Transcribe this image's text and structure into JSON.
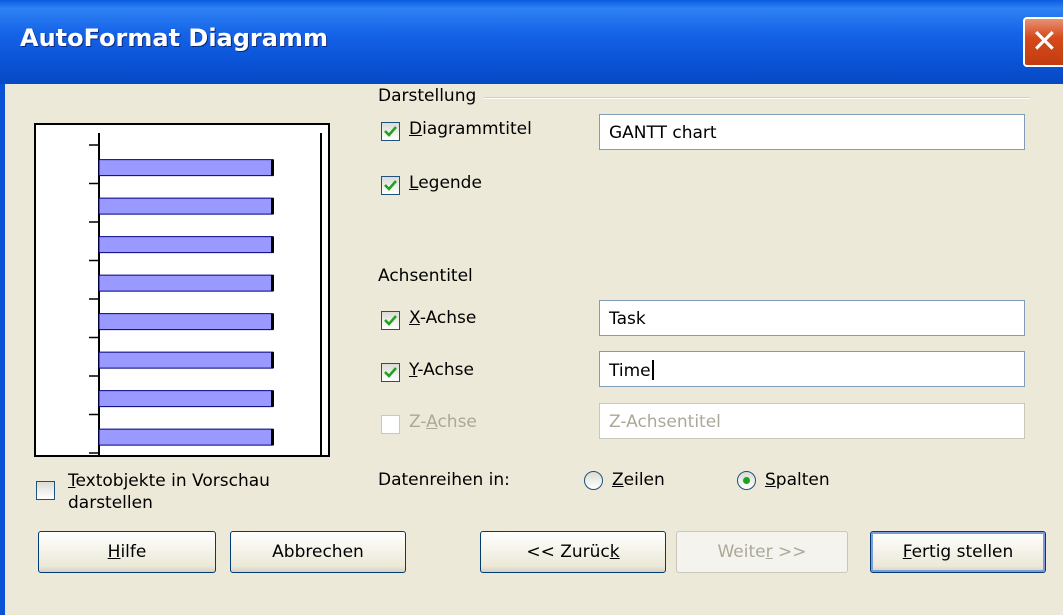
{
  "window": {
    "title": "AutoFormat Diagramm",
    "close_glyph": "✕"
  },
  "darstellung": {
    "heading": "Darstellung",
    "diagrammtitel": {
      "label_u": "D",
      "label_rest": "iagrammtitel",
      "checked": true,
      "value": "GANTT chart"
    },
    "legende": {
      "label_u": "L",
      "label_rest": "egende",
      "checked": true
    }
  },
  "achsentitel": {
    "heading": "Achsentitel",
    "x": {
      "label_u": "X",
      "label_rest": "-Achse",
      "checked": true,
      "value": "Task"
    },
    "y": {
      "label_u": "Y",
      "label_rest": "-Achse",
      "checked": true,
      "value": "Time"
    },
    "z": {
      "label_pre": "Z-",
      "label_u": "A",
      "label_rest": "chse",
      "checked": false,
      "disabled": true,
      "placeholder": "Z-Achsentitel"
    }
  },
  "preview": {
    "text_objects_u": "T",
    "text_objects_rest": "extobjekte in Vorschau",
    "text_objects_line2": "darstellen",
    "checked": false,
    "bar_count": 8
  },
  "datenreihen": {
    "label": "Datenreihen in:",
    "zeilen": {
      "label_u": "Z",
      "label_rest": "eilen",
      "selected": false
    },
    "spalten": {
      "label_u": "S",
      "label_rest": "palten",
      "selected": true
    }
  },
  "buttons": {
    "help": {
      "u": "H",
      "rest": "ilfe"
    },
    "cancel": {
      "label": "Abbrechen"
    },
    "back": {
      "pre": "<< Zurüc",
      "u": "k"
    },
    "next": {
      "pre": "Weite",
      "u": "r",
      "post": " >>",
      "disabled": true
    },
    "finish": {
      "u": "F",
      "rest": "ertig stellen"
    }
  },
  "colors": {
    "bar_fill": "#9999ff",
    "bar_edge": "#000080",
    "titlebar": "#0a52d6",
    "dialog_bg": "#ece9d8"
  }
}
